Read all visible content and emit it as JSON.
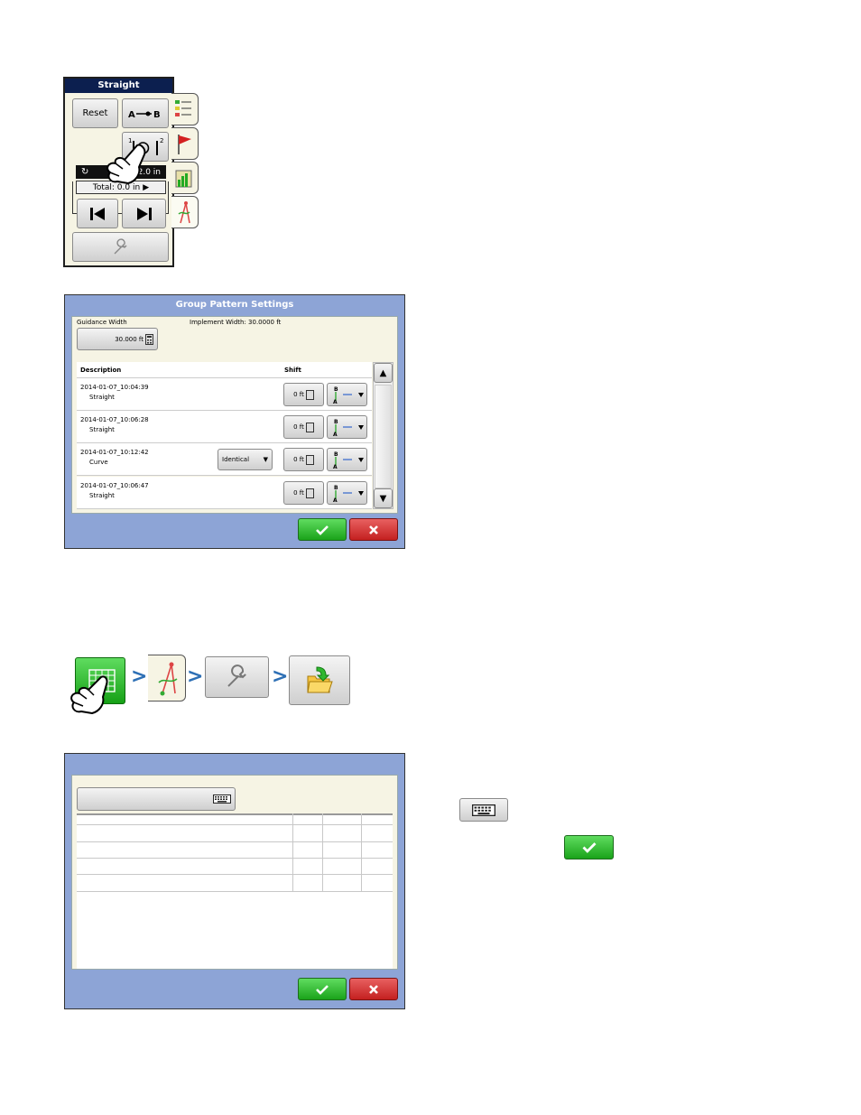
{
  "straight_panel": {
    "title": "Straight",
    "reset_label": "Reset",
    "ab_label": "A—●B",
    "nudge_value": "2.0 in",
    "total_label": "Total: 0.0 in"
  },
  "group_pattern": {
    "title": "Group Pattern Settings",
    "guidance_width_label": "Guidance Width",
    "guidance_width_value": "30.000 ft",
    "implement_width_label": "Implement Width: 30.0000 ft",
    "col_description": "Description",
    "col_shift": "Shift",
    "rows": [
      {
        "date": "2014-01-07_10:04:39",
        "type": "Straight",
        "shift": "0 ft",
        "dropdown": ""
      },
      {
        "date": "2014-01-07_10:06:28",
        "type": "Straight",
        "shift": "0 ft",
        "dropdown": ""
      },
      {
        "date": "2014-01-07_10:12:42",
        "type": "Curve",
        "shift": "0 ft",
        "dropdown": "Identical"
      },
      {
        "date": "2014-01-07_10:06:47",
        "type": "Straight",
        "shift": "0 ft",
        "dropdown": ""
      }
    ]
  },
  "colors": {
    "title_bar": "#0c1f4f",
    "window_blue": "#8da4d6",
    "panel_cream": "#f6f4e4",
    "ok_green": "#1aa31a",
    "cancel_red": "#c42020",
    "arrow_blue": "#2d6fb5"
  },
  "icons": [
    "map-grid-icon",
    "guidance-icon",
    "wrench-icon",
    "folder-import-icon",
    "keyboard-icon",
    "check-icon",
    "close-icon"
  ]
}
